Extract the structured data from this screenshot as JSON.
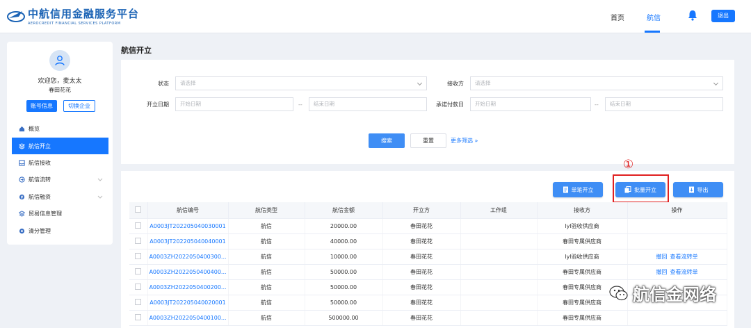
{
  "header": {
    "logo_cn": "中航信用金融服务平台",
    "logo_en": "AEROCREDIT FINANCIAL SERVICES PLATFORM",
    "nav": [
      "首页",
      "航信"
    ],
    "active_nav": "航信",
    "logout": "退出"
  },
  "sidebar": {
    "welcome": "欢迎您，麦太太",
    "company": "春田花花",
    "btn_account": "账号信息",
    "btn_switch": "切换企业",
    "items": [
      {
        "label": "概览",
        "icon": "home-icon"
      },
      {
        "label": "航信开立",
        "icon": "layers-icon",
        "active": true
      },
      {
        "label": "航信接收",
        "icon": "inbox-icon"
      },
      {
        "label": "航信流转",
        "icon": "transfer-icon",
        "expandable": true
      },
      {
        "label": "航信融资",
        "icon": "finance-icon",
        "expandable": true
      },
      {
        "label": "贸易信息管理",
        "icon": "layers-icon"
      },
      {
        "label": "清分管理",
        "icon": "settle-icon"
      }
    ]
  },
  "page": {
    "title": "航信开立"
  },
  "filters": {
    "status_label": "状态",
    "status_placeholder": "请选择",
    "receiver_label": "接收方",
    "receiver_placeholder": "请选择",
    "open_date_label": "开立日期",
    "start_placeholder": "开始日期",
    "end_placeholder": "结束日期",
    "pay_date_label": "承诺付款日",
    "range_sep": "--",
    "search": "搜索",
    "reset": "重置",
    "more": "更多筛选"
  },
  "annotation": {
    "marker": "①",
    "color": "#e02020"
  },
  "toolbar": {
    "single": "单笔开立",
    "batch": "批量开立",
    "export": "导出"
  },
  "table": {
    "columns": [
      "航信编号",
      "航信类型",
      "航信金额",
      "开立方",
      "工作组",
      "接收方",
      "操作"
    ],
    "rows": [
      {
        "id": "A0003JT202205040030001",
        "type": "航信",
        "amount": "20000.00",
        "issuer": "春田花花",
        "group": "",
        "receiver": "lyl验收供应商",
        "ops": []
      },
      {
        "id": "A0003JT202205040040001",
        "type": "航信",
        "amount": "40000.00",
        "issuer": "春田花花",
        "group": "",
        "receiver": "春田专属供应商",
        "ops": []
      },
      {
        "id": "A0003ZH2022050400300...",
        "type": "航信",
        "amount": "10000.00",
        "issuer": "春田花花",
        "group": "",
        "receiver": "lyl验收供应商",
        "ops": [
          "撤回",
          "查看流转单"
        ]
      },
      {
        "id": "A0003ZH2022050400400...",
        "type": "航信",
        "amount": "50000.00",
        "issuer": "春田花花",
        "group": "",
        "receiver": "春田专属供应商",
        "ops": [
          "撤回",
          "查看流转单"
        ]
      },
      {
        "id": "A0003ZH2022050400200...",
        "type": "航信",
        "amount": "50000.00",
        "issuer": "春田花花",
        "group": "",
        "receiver": "春田专属供应商",
        "ops": []
      },
      {
        "id": "A0003JT202205040020001",
        "type": "航信",
        "amount": "50000.00",
        "issuer": "春田花花",
        "group": "",
        "receiver": "春田专属供应商",
        "ops": []
      },
      {
        "id": "A0003ZH2022050400100...",
        "type": "航信",
        "amount": "500000.00",
        "issuer": "春田花花",
        "group": "",
        "receiver": "春田专属供应商",
        "ops": []
      }
    ]
  },
  "watermark": {
    "text": "航信金网络",
    "icon": "wechat-icon"
  },
  "colors": {
    "primary": "#1677ff",
    "annotation": "#e02020"
  }
}
